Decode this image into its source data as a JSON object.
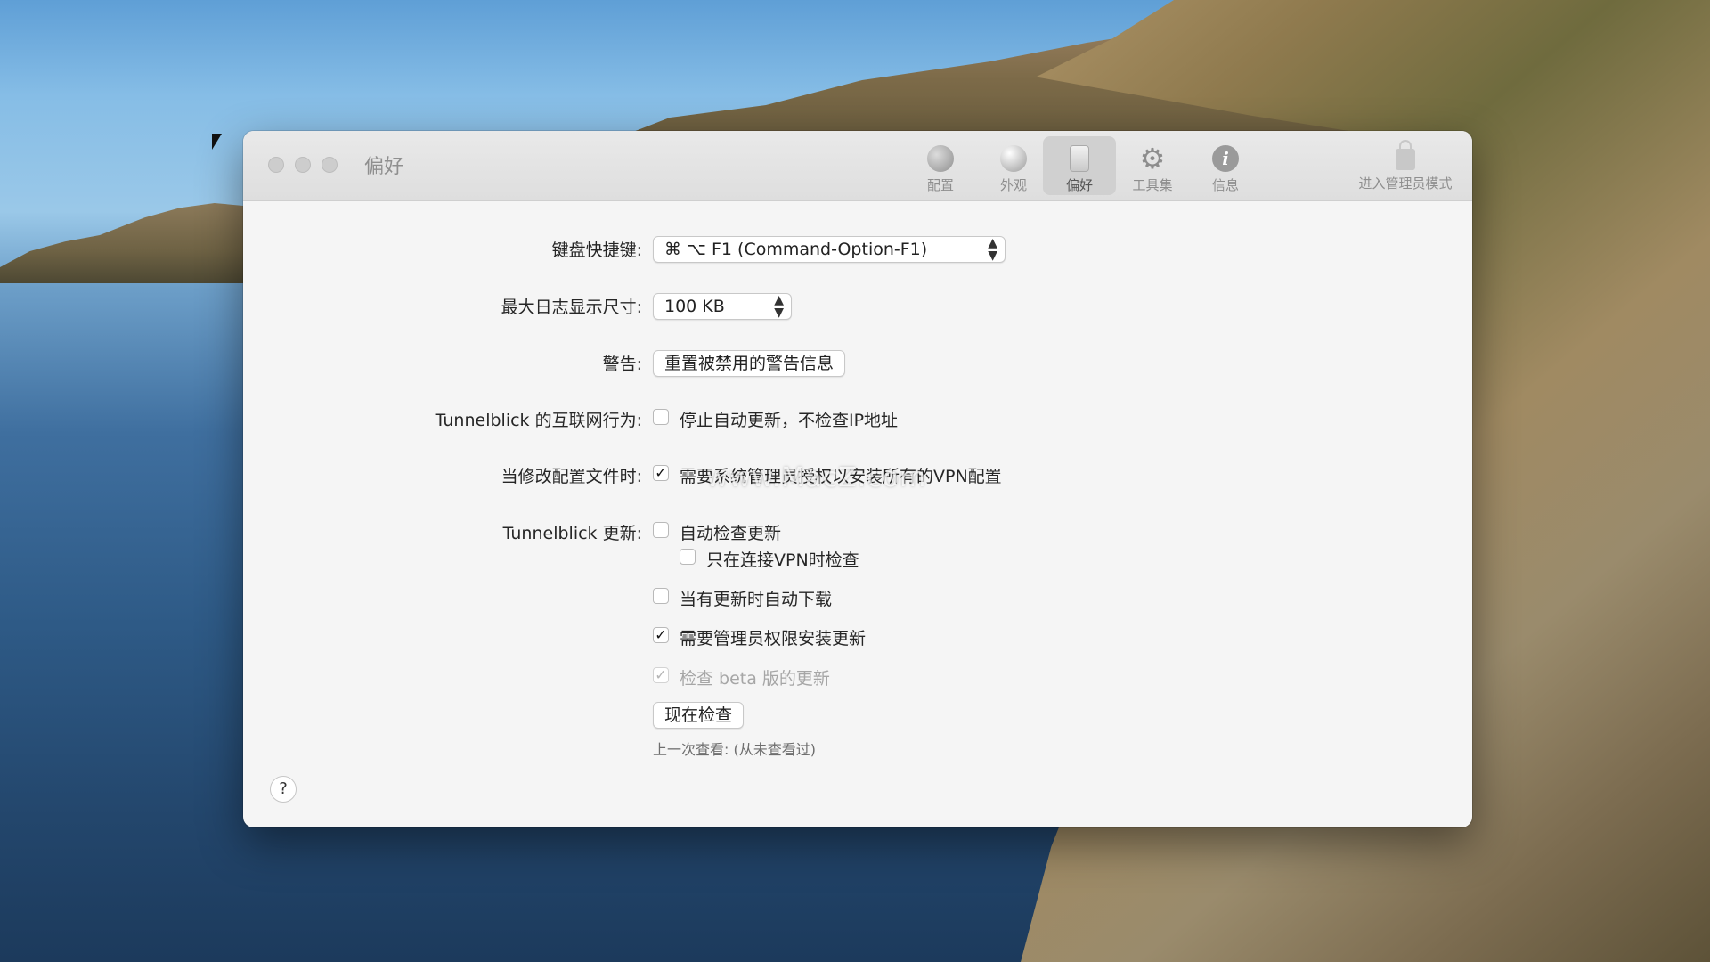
{
  "window": {
    "title": "偏好"
  },
  "toolbar": {
    "items": [
      {
        "label": "配置",
        "icon": "globe-icon"
      },
      {
        "label": "外观",
        "icon": "sphere-icon"
      },
      {
        "label": "偏好",
        "icon": "switch-icon",
        "active": true
      },
      {
        "label": "工具集",
        "icon": "gear-icon"
      },
      {
        "label": "信息",
        "icon": "info-icon"
      }
    ],
    "admin_label": "进入管理员模式"
  },
  "form": {
    "hotkey_label": "键盘快捷键:",
    "hotkey_value": "⌘ ⌥ F1 (Command-Option-F1)",
    "logsize_label": "最大日志显示尺寸:",
    "logsize_value": "100 KB",
    "warnings_label": "警告:",
    "warnings_button": "重置被禁用的警告信息",
    "internet_label": "Tunnelblick 的互联网行为:",
    "internet_checkbox": {
      "text": "停止自动更新，不检查IP地址",
      "checked": false
    },
    "config_label": "当修改配置文件时:",
    "config_checkbox": {
      "text": "需要系统管理员授权以安装所有的VPN配置",
      "checked": true
    },
    "update_label": "Tunnelblick 更新:",
    "auto_check": {
      "text": "自动检查更新",
      "checked": false
    },
    "vpn_only": {
      "text": "只在连接VPN时检查",
      "checked": false
    },
    "auto_download": {
      "text": "当有更新时自动下载",
      "checked": false
    },
    "admin_install": {
      "text": "需要管理员权限安装更新",
      "checked": true
    },
    "beta_check": {
      "text": "检查 beta 版的更新",
      "checked": true,
      "disabled": true
    },
    "check_now_button": "现在检查",
    "last_check": "上一次查看: (从未查看过)"
  },
  "help_button": "?",
  "watermark": "www.MacZ.com",
  "checkmark": "✓",
  "chevron": "⌃⌄",
  "colors": {
    "window_bg": "#f5f5f5",
    "titlebar_bg": "#e4e4e4",
    "text": "#262626",
    "muted": "#8e8e8e"
  }
}
